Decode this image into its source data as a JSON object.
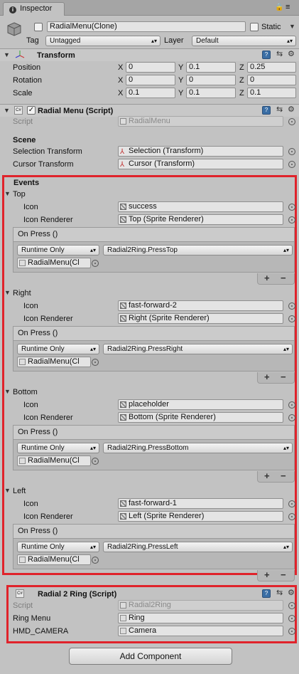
{
  "tab": {
    "title": "Inspector"
  },
  "gameobject": {
    "name": "RadialMenu(Clone)",
    "static_label": "Static",
    "tag_label": "Tag",
    "tag_value": "Untagged",
    "layer_label": "Layer",
    "layer_value": "Default"
  },
  "transform": {
    "title": "Transform",
    "rows": [
      {
        "label": "Position",
        "x": "0",
        "y": "0.1",
        "z": "0.25"
      },
      {
        "label": "Rotation",
        "x": "0",
        "y": "0",
        "z": "0"
      },
      {
        "label": "Scale",
        "x": "0.1",
        "y": "0.1",
        "z": "0.1"
      }
    ],
    "axis": {
      "x": "X",
      "y": "Y",
      "z": "Z"
    }
  },
  "radial_menu": {
    "title": "Radial Menu (Script)",
    "script_label": "Script",
    "script_value": "RadialMenu",
    "scene_header": "Scene",
    "selection_label": "Selection Transform",
    "selection_value": "Selection (Transform)",
    "cursor_label": "Cursor Transform",
    "cursor_value": "Cursor (Transform)",
    "events_header": "Events",
    "icon_label": "Icon",
    "renderer_label": "Icon Renderer",
    "on_press_label": "On Press ()",
    "runtime_label": "Runtime Only",
    "target_value": "RadialMenu(Cl",
    "plus": "+",
    "minus": "−",
    "events": [
      {
        "name": "Top",
        "icon": "success",
        "renderer": "Top (Sprite Renderer)",
        "method": "Radial2Ring.PressTop"
      },
      {
        "name": "Right",
        "icon": "fast-forward-2",
        "renderer": "Right (Sprite Renderer)",
        "method": "Radial2Ring.PressRight"
      },
      {
        "name": "Bottom",
        "icon": "placeholder",
        "renderer": "Bottom (Sprite Renderer)",
        "method": "Radial2Ring.PressBottom"
      },
      {
        "name": "Left",
        "icon": "fast-forward-1",
        "renderer": "Left (Sprite Renderer)",
        "method": "Radial2Ring.PressLeft"
      }
    ]
  },
  "radial2ring": {
    "title": "Radial 2 Ring (Script)",
    "script_label": "Script",
    "script_value": "Radial2Ring",
    "ring_label": "Ring Menu",
    "ring_value": "Ring",
    "camera_label": "HMD_CAMERA",
    "camera_value": "Camera"
  },
  "add_component": "Add Component",
  "colors": {
    "highlight": "#e0232b",
    "background": "#c2c2c2"
  }
}
